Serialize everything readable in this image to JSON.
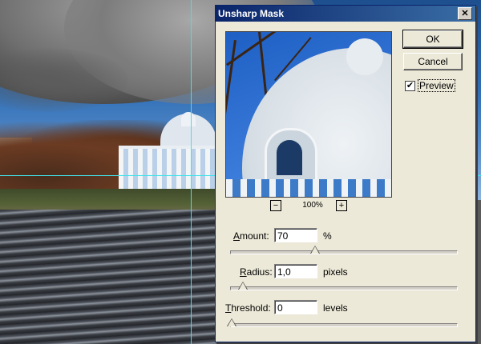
{
  "dialog": {
    "title": "Unsharp Mask",
    "close_label": "✕",
    "ok_label": "OK",
    "cancel_label": "Cancel",
    "preview_label": "Preview",
    "preview_checked": true,
    "checkmark": "✔",
    "zoom": {
      "minus_label": "−",
      "plus_label": "+",
      "percent": "100%"
    },
    "amount": {
      "label_first": "A",
      "label_rest": "mount:",
      "value": "70",
      "unit": "%",
      "slider_fraction": 0.37
    },
    "radius": {
      "label_first": "R",
      "label_rest": "adius:",
      "value": "1,0",
      "unit": "pixels",
      "slider_fraction": 0.05
    },
    "threshold": {
      "label_first": "T",
      "label_rest": "hreshold:",
      "value": "0",
      "unit": "levels",
      "slider_fraction": 0.0
    }
  },
  "colors": {
    "titlebar_start": "#0a246a",
    "titlebar_end": "#3a6ea5",
    "dialog_face": "#ece9d8",
    "guide_line": "#41e2ea"
  }
}
